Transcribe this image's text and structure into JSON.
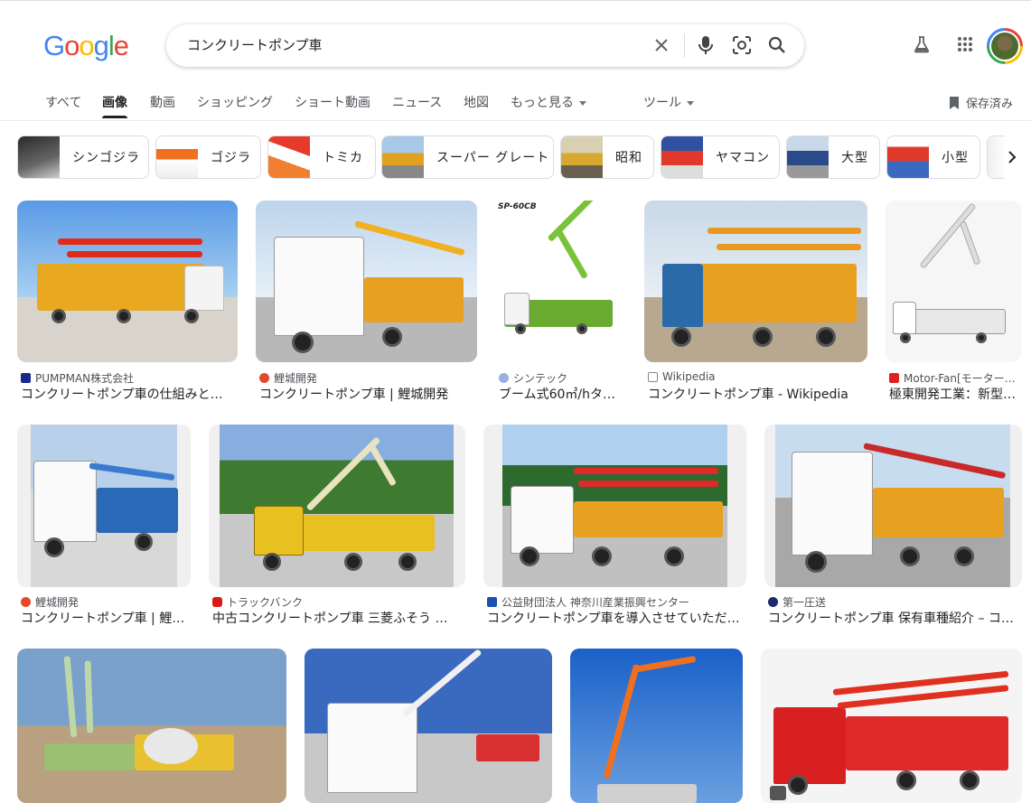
{
  "search": {
    "query": "コンクリートポンプ車"
  },
  "tabs": [
    "すべて",
    "画像",
    "動画",
    "ショッピング",
    "ショート動画",
    "ニュース",
    "地図",
    "もっと見る",
    "ツール"
  ],
  "saved_label": "保存済み",
  "chips": [
    "シンゴジラ",
    "ゴジラ",
    "トミカ",
    "スーパー グレート",
    "昭和",
    "ヤマコン",
    "大型",
    "小型"
  ],
  "results": [
    {
      "source": "PUMPMAN株式会社",
      "title": "コンクリートポンプ車の仕組みと…"
    },
    {
      "source": "鯉城開発",
      "title": "コンクリートポンプ車 | 鯉城開発"
    },
    {
      "source": "シンテック",
      "title": "ブーム式60㎥/hタ…",
      "badge": "SP-60CB"
    },
    {
      "source": "Wikipedia",
      "title": "コンクリートポンプ車 - Wikipedia"
    },
    {
      "source": "Motor-Fan[モーター…",
      "title": "極東開発工業：新型…"
    },
    {
      "source": "鯉城開発",
      "title": "コンクリートポンプ車 | 鯉…"
    },
    {
      "source": "トラックバンク",
      "title": "中古コンクリートポンプ車 三菱ふそう …"
    },
    {
      "source": "公益財団法人 神奈川産業振興センター",
      "title": "コンクリートポンプ車を導入させていただ…"
    },
    {
      "source": "第一圧送",
      "title": "コンクリートポンプ車 保有車種紹介 – コ…"
    },
    {
      "source": "",
      "title": ""
    },
    {
      "source": "",
      "title": ""
    },
    {
      "source": "",
      "title": ""
    },
    {
      "source": "",
      "title": ""
    }
  ],
  "colors": {
    "google_blue": "#4285f4",
    "google_red": "#ea4335",
    "google_yellow": "#fbbc05",
    "google_green": "#34a853"
  }
}
